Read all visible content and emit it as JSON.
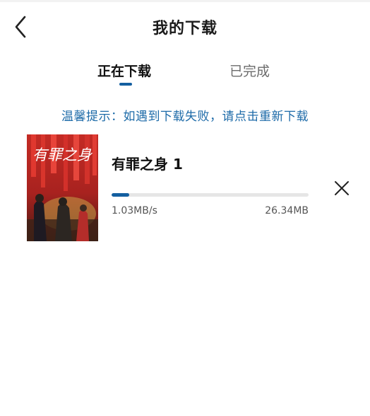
{
  "header": {
    "title": "我的下载",
    "back_icon": "chevron-left-icon"
  },
  "tabs": [
    {
      "label": "正在下载",
      "active": true
    },
    {
      "label": "已完成",
      "active": false
    }
  ],
  "tip": "温馨提示：如遇到下载失败，请点击重新下载",
  "download_item": {
    "title": "有罪之身 1",
    "poster_text": "有罪之身",
    "progress_fraction": 0.09,
    "speed": "1.03MB/s",
    "size": "26.34MB",
    "close_icon": "close-icon"
  },
  "colors": {
    "accent": "#145fa0",
    "tip": "#1c6aa8",
    "track": "#e6e6e6"
  }
}
